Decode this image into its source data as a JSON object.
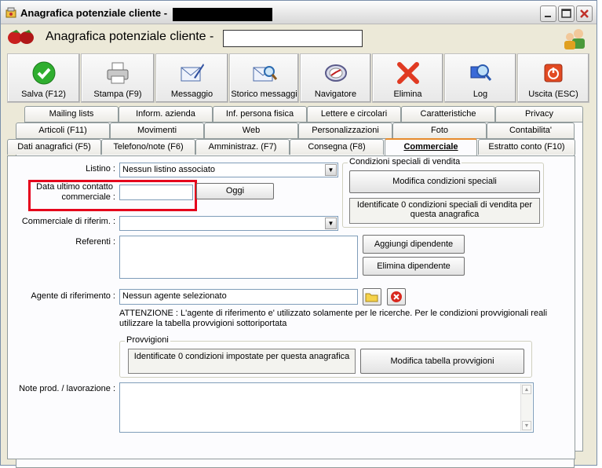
{
  "window": {
    "title": "Anagrafica potenziale cliente -",
    "minimize_label": "_",
    "maximize_label": "□",
    "close_label": "✕"
  },
  "header": {
    "title": "Anagrafica potenziale cliente -"
  },
  "toolbar": {
    "buttons": [
      {
        "label": "Salva (F12)",
        "icon": "check-icon"
      },
      {
        "label": "Stampa (F9)",
        "icon": "printer-icon"
      },
      {
        "label": "Messaggio",
        "icon": "message-icon"
      },
      {
        "label": "Storico messaggi",
        "icon": "message-history-icon"
      },
      {
        "label": "Navigatore",
        "icon": "compass-icon"
      },
      {
        "label": "Elimina",
        "icon": "delete-x-icon"
      },
      {
        "label": "Log",
        "icon": "log-icon"
      },
      {
        "label": "Uscita (ESC)",
        "icon": "power-icon"
      }
    ]
  },
  "tabs": {
    "row1": [
      "Mailing lists",
      "Inform. azienda",
      "Inf. persona fisica",
      "Lettere e circolari",
      "Caratteristiche",
      "Privacy"
    ],
    "row2": [
      "Articoli (F11)",
      "Movimenti",
      "Web",
      "Personalizzazioni",
      "Foto",
      "Contabilita'"
    ],
    "row3": [
      "Dati anagrafici (F5)",
      "Telefono/note (F6)",
      "Amministraz. (F7)",
      "Consegna (F8)",
      "Commerciale",
      "Estratto conto (F10)"
    ],
    "active": "Commerciale"
  },
  "form": {
    "listino_label": "Listino :",
    "listino_value": "Nessun listino associato",
    "data_contatto_label_1": "Data ultimo contatto",
    "data_contatto_label_2": "commerciale :",
    "data_contatto_value": "",
    "oggi_button": "Oggi",
    "commerciale_label": "Commerciale di riferim. :",
    "commerciale_value": "",
    "referenti_label": "Referenti :",
    "aggiungi_button": "Aggiungi dipendente",
    "elimina_button": "Elimina dipendente",
    "agente_label": "Agente di riferimento :",
    "agente_value": "Nessun agente selezionato",
    "attenzione_1": "ATTENZIONE : L'agente di riferimento e' utilizzato solamente per le ricerche. Per le condizioni provvigionali reali",
    "attenzione_2": "utilizzare la tabella provvigioni sottoriportata",
    "note_label": "Note prod. / lavorazione :"
  },
  "condizioni": {
    "title": "Condizioni speciali di vendita",
    "button": "Modifica condizioni speciali",
    "info_1": "Identificate 0 condizioni speciali di vendita per",
    "info_2": "questa anagrafica"
  },
  "provvigioni": {
    "title": "Provvigioni",
    "info": "Identificate 0 condizioni impostate per questa anagrafica",
    "button": "Modifica tabella provvigioni"
  },
  "colors": {
    "highlight": "#e5001c",
    "active_tab_accent": "#e68b2c"
  }
}
